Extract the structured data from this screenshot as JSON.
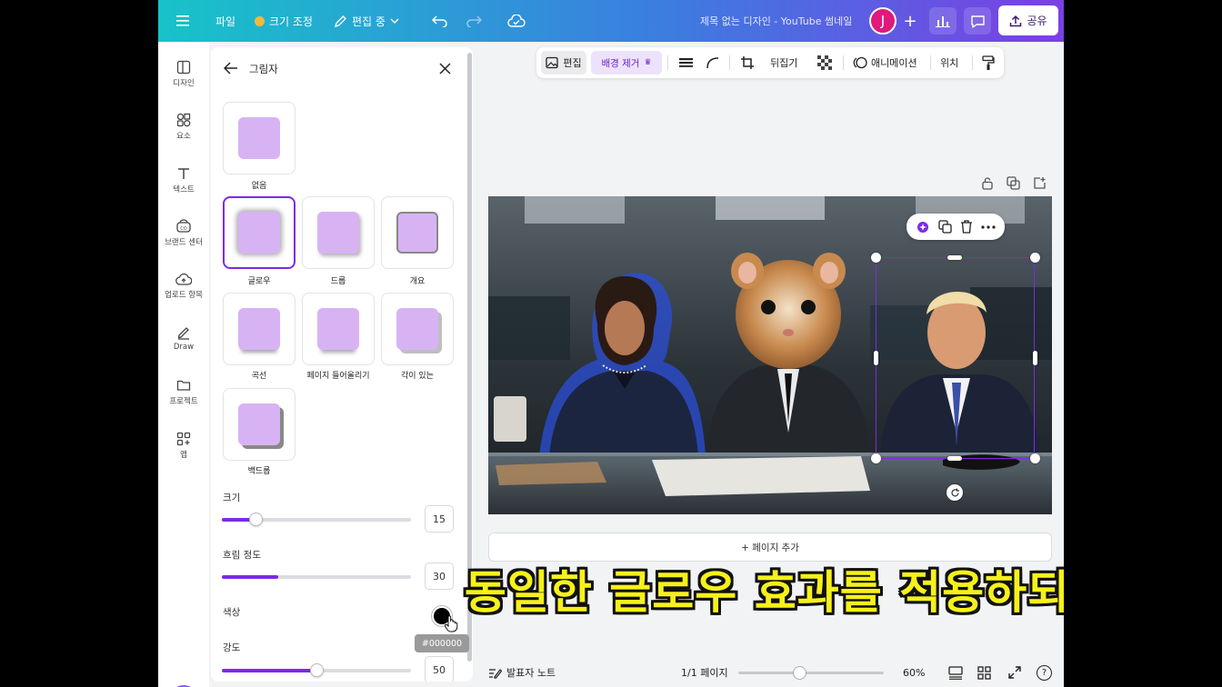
{
  "topbar": {
    "menu_icon": "hamburger-icon",
    "file_label": "파일",
    "resize_label": "크기 조정",
    "editing_label": "편집 중",
    "doc_title": "제목 없는 디자인 - YouTube 썸네일",
    "avatar_letter": "J",
    "share_label": "공유"
  },
  "rail": {
    "items": [
      {
        "label": "디자인",
        "icon": "layout-icon"
      },
      {
        "label": "요소",
        "icon": "shapes-icon"
      },
      {
        "label": "텍스트",
        "icon": "text-icon"
      },
      {
        "label": "브랜드 센터",
        "icon": "brand-icon"
      },
      {
        "label": "업로드 항목",
        "icon": "cloud-upload-icon"
      },
      {
        "label": "Draw",
        "icon": "pen-icon"
      },
      {
        "label": "프로젝트",
        "icon": "folder-icon"
      },
      {
        "label": "앱",
        "icon": "apps-icon"
      }
    ]
  },
  "panel": {
    "title": "그림자",
    "options": [
      {
        "label": "없음",
        "selected": false
      },
      {
        "label": "글로우",
        "selected": true
      },
      {
        "label": "드롭",
        "selected": false
      },
      {
        "label": "개요",
        "selected": false
      },
      {
        "label": "곡선",
        "selected": false
      },
      {
        "label": "페이지 들어올리기",
        "selected": false
      },
      {
        "label": "각이 있는",
        "selected": false
      },
      {
        "label": "백드롭",
        "selected": false
      }
    ],
    "size_label": "크기",
    "size_value": "15",
    "blur_label": "흐림 정도",
    "blur_value": "30",
    "color_label": "색상",
    "color_value": "#000000",
    "intensity_label": "강도",
    "intensity_value": "50",
    "swatch_color": "#d7b3f4",
    "accent_color": "#7d2ae8"
  },
  "context_toolbar": {
    "edit_label": "편집",
    "bg_remove_label": "배경 제거",
    "flip_label": "뒤집기",
    "animate_label": "애니메이션",
    "position_label": "위치"
  },
  "canvas": {
    "add_page_label": "+ 페이지 추가"
  },
  "bottombar": {
    "notes_label": "발표자 노트",
    "page_count": "1/1 페이지",
    "zoom": "60%",
    "zoom_level": 0.42,
    "help": "?"
  },
  "subtitle": "동일한 글로우 효과를 적용하되"
}
